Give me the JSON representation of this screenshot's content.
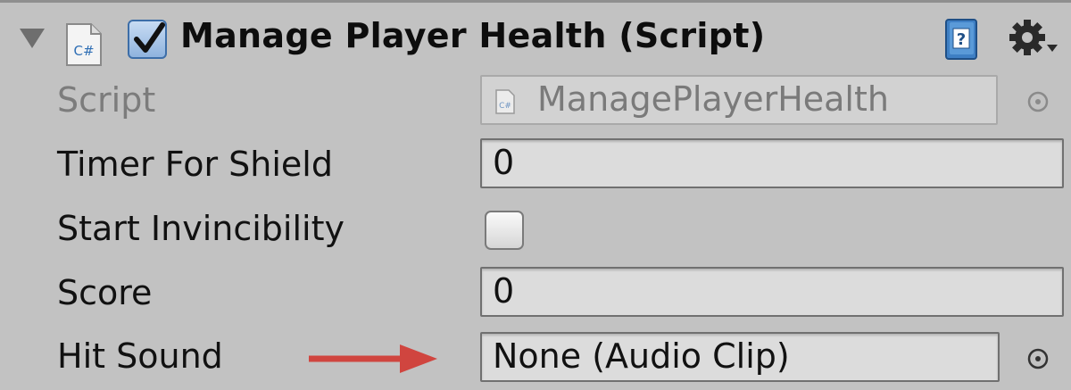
{
  "component": {
    "title": "Manage Player Health (Script)",
    "enabled": true,
    "icons": [
      "foldout-triangle-icon",
      "csharp-script-icon",
      "help-book-icon",
      "gear-icon"
    ]
  },
  "fields": {
    "script": {
      "label": "Script",
      "value": "ManagePlayerHealth"
    },
    "timer_for_shield": {
      "label": "Timer For Shield",
      "value": "0"
    },
    "start_invincibility": {
      "label": "Start Invincibility",
      "checked": false
    },
    "score": {
      "label": "Score",
      "value": "0"
    },
    "hit_sound": {
      "label": "Hit Sound",
      "value": "None (Audio Clip)"
    }
  },
  "icon_text": {
    "cs": "C#"
  },
  "colors": {
    "annotation_arrow": "#d0453f",
    "checkbox_blue": "#3d6ea8",
    "panel_bg": "#c2c2c2"
  }
}
